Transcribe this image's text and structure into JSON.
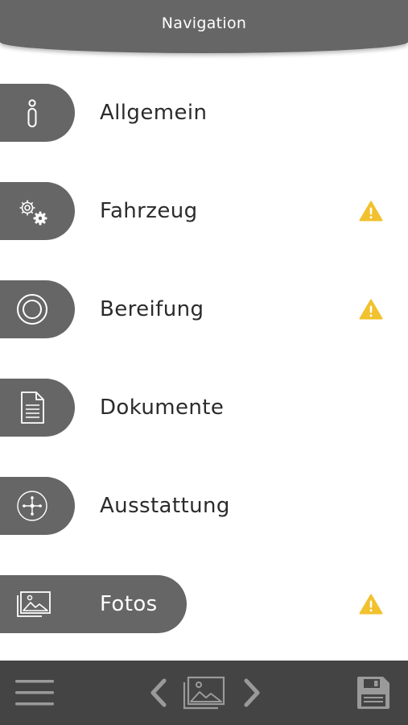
{
  "header": {
    "title": "Navigation"
  },
  "nav": {
    "items": [
      {
        "label": "Allgemein",
        "icon": "info-icon",
        "warning": false,
        "active": false
      },
      {
        "label": "Fahrzeug",
        "icon": "gears-icon",
        "warning": true,
        "active": false
      },
      {
        "label": "Bereifung",
        "icon": "tire-icon",
        "warning": true,
        "active": false
      },
      {
        "label": "Dokumente",
        "icon": "document-icon",
        "warning": false,
        "active": false
      },
      {
        "label": "Ausstattung",
        "icon": "equipment-icon",
        "warning": false,
        "active": false
      },
      {
        "label": "Fotos",
        "icon": "photos-icon",
        "warning": true,
        "active": true
      }
    ]
  },
  "bottom_bar": {
    "icons": [
      "menu-icon",
      "chevron-left-icon",
      "gallery-icon",
      "chevron-right-icon",
      "save-icon"
    ]
  },
  "colors": {
    "pill": "#666666",
    "bottom_bar": "#444444",
    "warning": "#f2c12e",
    "text": "#2b2b2b"
  }
}
